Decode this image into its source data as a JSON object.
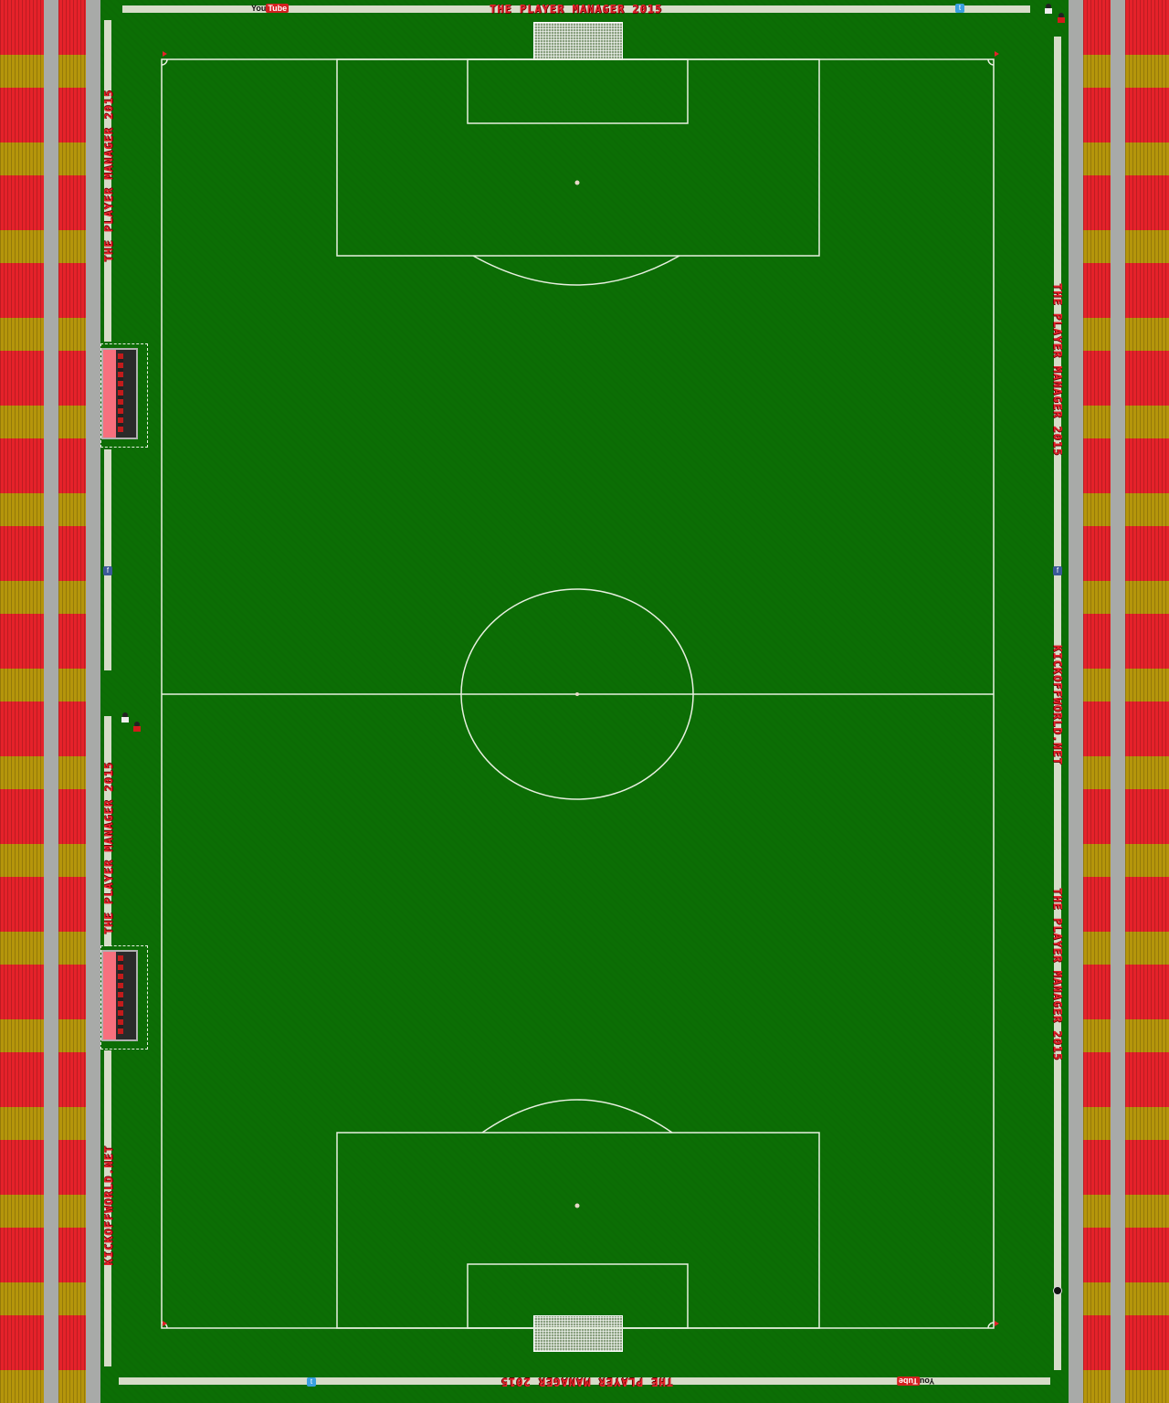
{
  "ads": {
    "top_title": "THE PLAYER MANAGER 2015",
    "bottom_title": "THE PLAYER MANAGER 2015",
    "left_top": "THE PLAYER MANAGER 2015",
    "left_middle": "THE PLAYER MANAGER 2015",
    "left_bottom": "KICKOFFWORLD.NET",
    "right_top": "THE PLAYER MANAGER 2015",
    "right_middle": "KICKOFFWORLD.NET",
    "right_bottom": "THE PLAYER MANAGER 2015",
    "youtube_you": "You",
    "youtube_tube": "Tube",
    "facebook_glyph": "f",
    "twitter_glyph": "t"
  },
  "colors": {
    "grass": "#0c6e05",
    "lines": "#e8f0e0",
    "seat_red": "#e5222a",
    "seat_gold": "#b5950b",
    "ad_text": "#e5222a",
    "bench_seat": "#f7707e"
  },
  "icons": {
    "youtube": "youtube-logo-icon",
    "twitter": "twitter-icon",
    "facebook": "facebook-icon",
    "player": "player-sprite-icon",
    "ball": "ball-icon"
  }
}
